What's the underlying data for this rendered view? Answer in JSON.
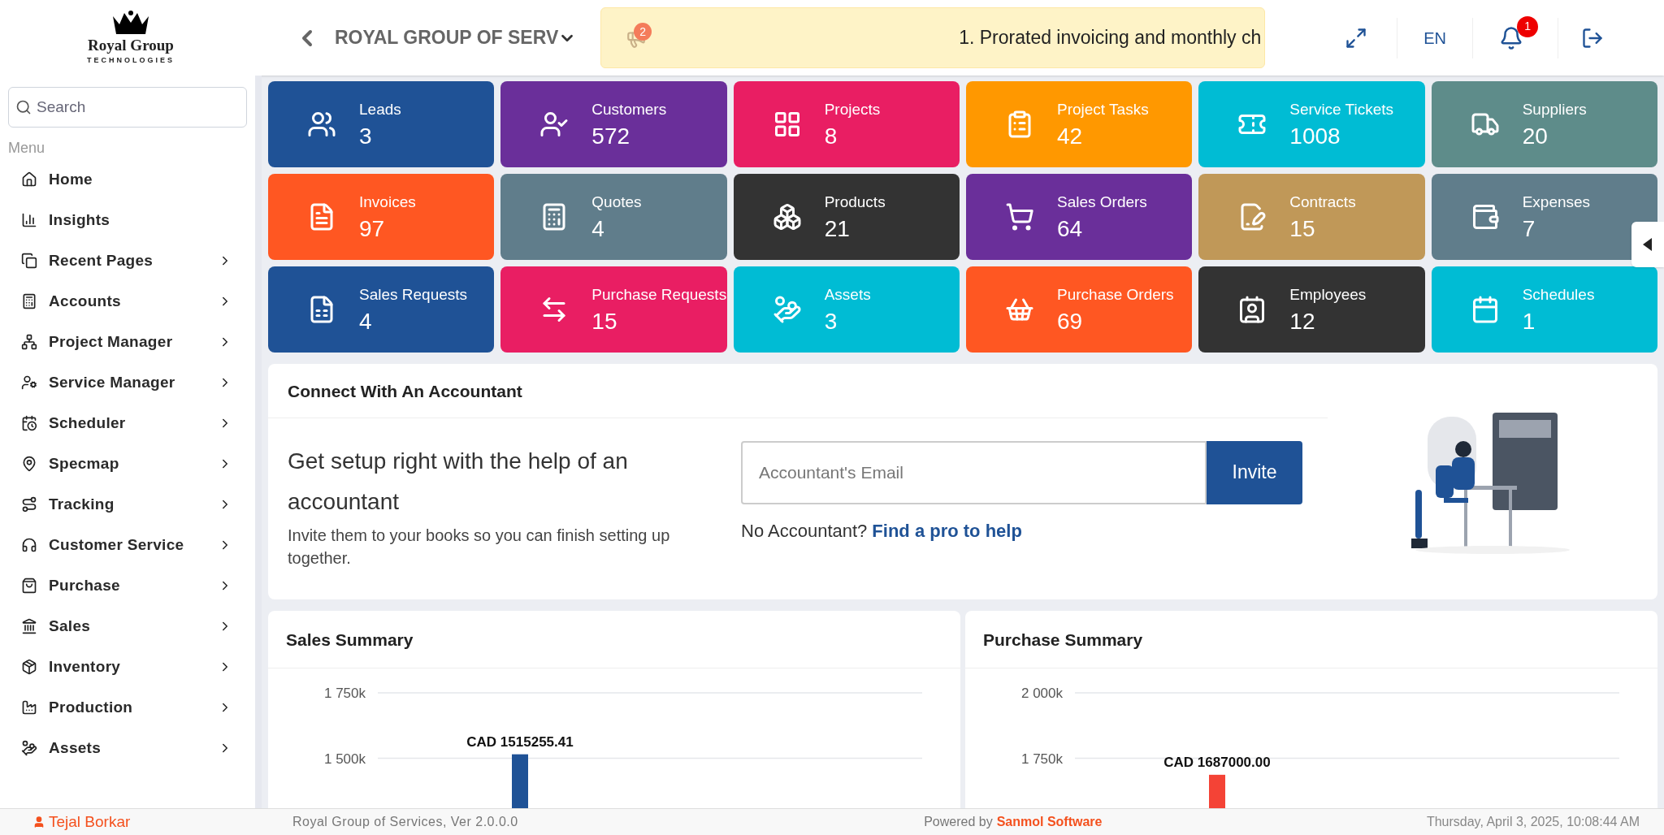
{
  "header": {
    "logo_name": "Royal Group",
    "logo_tagline": "TECHNOLOGIES",
    "company": "ROYAL GROUP OF SERV",
    "notice_count": "2",
    "notice_text": "1. Prorated invoicing and monthly ch",
    "language": "EN",
    "notification_count": "1"
  },
  "sidebar": {
    "search_placeholder": "Search",
    "menu_label": "Menu",
    "items": [
      {
        "label": "Home",
        "has_submenu": false
      },
      {
        "label": "Insights",
        "has_submenu": false
      },
      {
        "label": "Recent Pages",
        "has_submenu": true
      },
      {
        "label": "Accounts",
        "has_submenu": true
      },
      {
        "label": "Project Manager",
        "has_submenu": true
      },
      {
        "label": "Service Manager",
        "has_submenu": true
      },
      {
        "label": "Scheduler",
        "has_submenu": true
      },
      {
        "label": "Specmap",
        "has_submenu": true
      },
      {
        "label": "Tracking",
        "has_submenu": true
      },
      {
        "label": "Customer Service",
        "has_submenu": true
      },
      {
        "label": "Purchase",
        "has_submenu": true
      },
      {
        "label": "Sales",
        "has_submenu": true
      },
      {
        "label": "Inventory",
        "has_submenu": true
      },
      {
        "label": "Production",
        "has_submenu": true
      },
      {
        "label": "Assets",
        "has_submenu": true
      }
    ]
  },
  "tiles": [
    {
      "label": "Leads",
      "count": "3",
      "color": "#1f5296"
    },
    {
      "label": "Customers",
      "count": "572",
      "color": "#6a2f9a"
    },
    {
      "label": "Projects",
      "count": "8",
      "color": "#e91e63"
    },
    {
      "label": "Project Tasks",
      "count": "42",
      "color": "#ff9800"
    },
    {
      "label": "Service Tickets",
      "count": "1008",
      "color": "#00bcd4"
    },
    {
      "label": "Suppliers",
      "count": "20",
      "color": "#5e8c8a"
    },
    {
      "label": "Invoices",
      "count": "97",
      "color": "#ff5722"
    },
    {
      "label": "Quotes",
      "count": "4",
      "color": "#607d8b"
    },
    {
      "label": "Products",
      "count": "21",
      "color": "#333333"
    },
    {
      "label": "Sales Orders",
      "count": "64",
      "color": "#6a2f9a"
    },
    {
      "label": "Contracts",
      "count": "15",
      "color": "#c09858"
    },
    {
      "label": "Expenses",
      "count": "7",
      "color": "#607d8b"
    },
    {
      "label": "Sales Requests",
      "count": "4",
      "color": "#1f5296"
    },
    {
      "label": "Purchase Requests",
      "count": "15",
      "color": "#e91e63"
    },
    {
      "label": "Assets",
      "count": "3",
      "color": "#00bcd4"
    },
    {
      "label": "Purchase Orders",
      "count": "69",
      "color": "#ff5722"
    },
    {
      "label": "Employees",
      "count": "12",
      "color": "#333333"
    },
    {
      "label": "Schedules",
      "count": "1",
      "color": "#00bcd4"
    }
  ],
  "accountant": {
    "title": "Connect With An Accountant",
    "headline": "Get setup right with the help of an accountant",
    "description": "Invite them to your books so you can finish setting up together.",
    "email_placeholder": "Accountant's Email",
    "invite_button": "Invite",
    "no_accountant": "No Accountant?",
    "link": "Find a pro to help"
  },
  "sales_summary": {
    "title": "Sales Summary",
    "chart_data": {
      "type": "bar",
      "values": [
        1515255.41
      ],
      "ylim": [
        1300000,
        1750000
      ],
      "yticks": [
        {
          "value": 1500000,
          "label": "1 500k"
        },
        {
          "value": 1750000,
          "label": "1 750k"
        }
      ],
      "value_labels": [
        "CAD 1515255.41"
      ]
    }
  },
  "purchase_summary": {
    "title": "Purchase Summary",
    "chart_data": {
      "type": "bar",
      "values": [
        1687000.0
      ],
      "ylim": [
        1550000,
        2000000
      ],
      "yticks": [
        {
          "value": 1750000,
          "label": "1 750k"
        },
        {
          "value": 2000000,
          "label": "2 000k"
        }
      ],
      "value_labels": [
        "CAD 1687000.00"
      ]
    }
  },
  "footer": {
    "user": "Tejal Borkar",
    "version": "Royal Group of Services, Ver 2.0.0.0",
    "powered_by": "Powered by",
    "vendor": "Sanmol Software",
    "datetime": "Thursday, April 3, 2025, 10:08:44 AM"
  }
}
